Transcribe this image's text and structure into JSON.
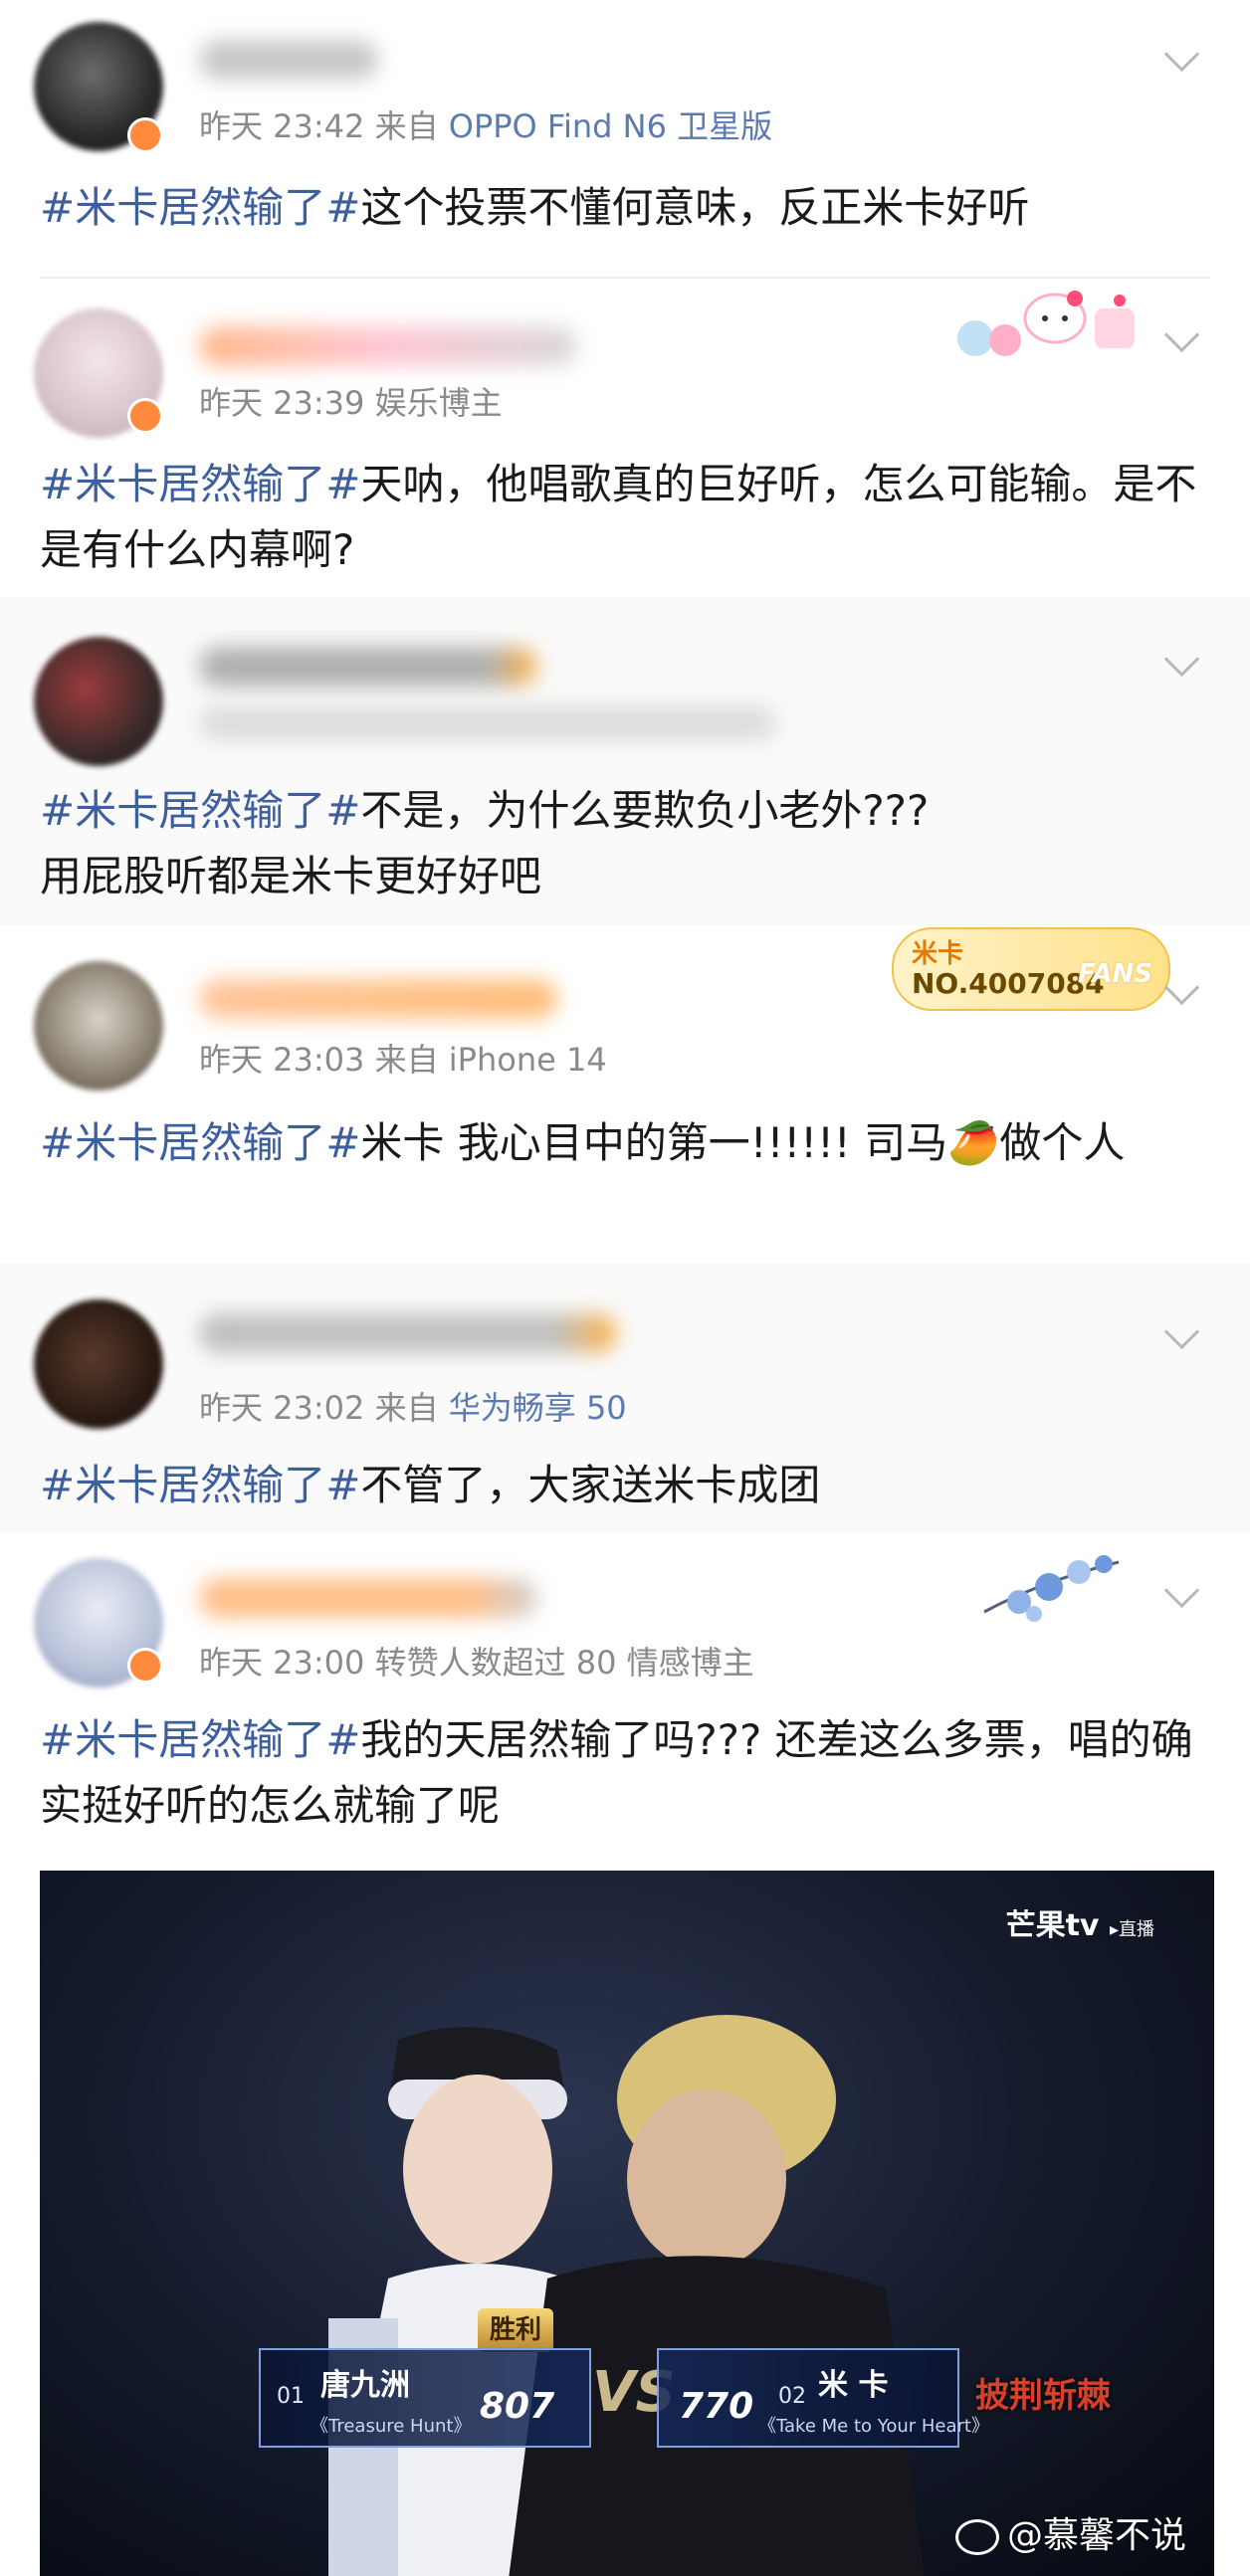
{
  "posts": [
    {
      "meta_time": "昨天 23:42",
      "meta_prefix": "来自",
      "meta_source": "OPPO Find N6 卫星版",
      "hashtag": "#米卡居然输了#",
      "text": "这个投票不懂何意味，反正米卡好听"
    },
    {
      "meta_time": "昨天 23:39",
      "meta_extra": "娱乐博主",
      "hashtag": "#米卡居然输了#",
      "text": "天呐，他唱歌真的巨好听，怎么可能输。是不是有什么内幕啊?"
    },
    {
      "hashtag": "#米卡居然输了#",
      "text_line1": "不是，为什么要欺负小老外???",
      "text_line2": "用屁股听都是米卡更好好吧"
    },
    {
      "meta_time": "昨天 23:03",
      "meta_prefix": "来自",
      "meta_source": "iPhone 14",
      "fans_badge": {
        "name": "米卡",
        "number": "NO.4007084",
        "label": "FANS"
      },
      "hashtag": "#米卡居然输了#",
      "text": "米卡 我心目中的第一!!!!!!  司马🥭做个人"
    },
    {
      "meta_time": "昨天 23:02",
      "meta_prefix": "来自",
      "meta_source": "华为畅享 50",
      "hashtag": "#米卡居然输了#",
      "text": "不管了，大家送米卡成团"
    },
    {
      "meta_time": "昨天 23:00",
      "meta_extra": "转赞人数超过 80  情感博主",
      "hashtag": "#米卡居然输了#",
      "text": "我的天居然输了吗??? 还差这么多票，唱的确实挺好听的怎么就输了呢"
    }
  ],
  "photo": {
    "logo": "芒果tv",
    "logo_sub": "▸直播",
    "win_label": "胜利",
    "left": {
      "num": "01",
      "name": "唐九洲",
      "song": "《Treasure Hunt》",
      "score": "807"
    },
    "right": {
      "num": "02",
      "name": "米 卡",
      "song": "《Take Me to Your Heart》",
      "score": "770"
    },
    "vs": "VS",
    "show_logo": "披荆斩棘",
    "watermark": "@慕馨不说"
  },
  "colors": {
    "hashtag": "#3d5f9e",
    "meta": "#8a8a8a",
    "source_link": "#5b7bb0"
  }
}
